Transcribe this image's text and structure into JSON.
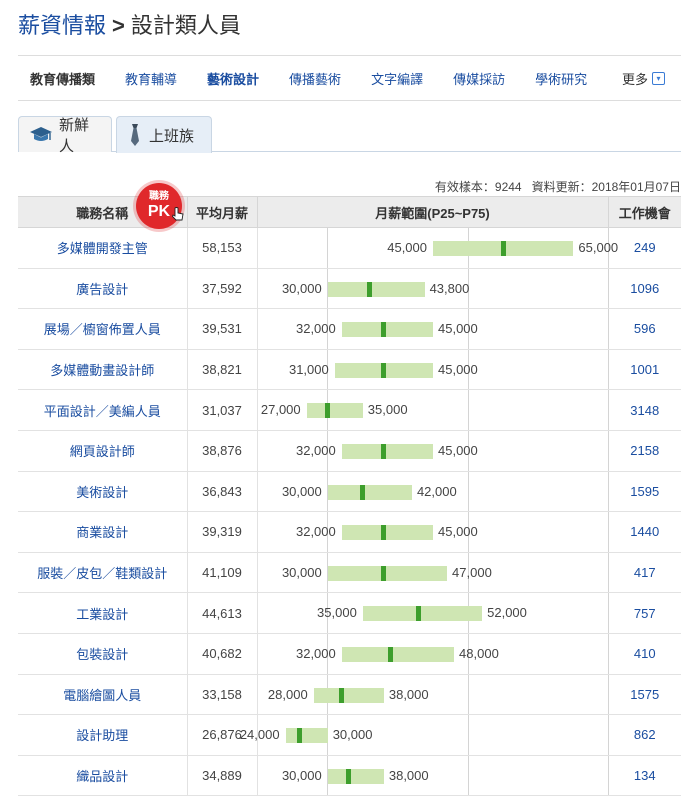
{
  "breadcrumb": {
    "root": "薪資情報",
    "separator": ">",
    "current": "設計類人員"
  },
  "categories": {
    "items": [
      {
        "label": "教育傳播類",
        "type": "first"
      },
      {
        "label": "教育輔導",
        "type": "link"
      },
      {
        "label": "藝術設計",
        "type": "active"
      },
      {
        "label": "傳播藝術",
        "type": "link"
      },
      {
        "label": "文字編譯",
        "type": "link"
      },
      {
        "label": "傳媒採訪",
        "type": "link"
      },
      {
        "label": "學術研究",
        "type": "link"
      }
    ],
    "more_label": "更多",
    "more_icon": "▾"
  },
  "tabs": [
    {
      "label": "新鮮人",
      "icon": "graduation-cap-icon"
    },
    {
      "label": "上班族",
      "icon": "necktie-icon"
    }
  ],
  "meta": {
    "sample": "有效樣本：9244",
    "updated": "資料更新：2018年01月07日"
  },
  "table": {
    "headers": {
      "name": "職務名稱",
      "avg": "平均月薪",
      "range": "月薪範圍(P25~P75)",
      "count": "工作機會"
    },
    "pk_badge": {
      "line1": "職務",
      "line2": "PK"
    },
    "scale_min": 20000,
    "scale_max": 70000,
    "rows": [
      {
        "name": "多媒體開發主管",
        "avg": "58,153",
        "p25": "45,000",
        "p75": "65,000",
        "p25_value": 45000,
        "p75_value": 65000,
        "median_value": 55000,
        "count": "249"
      },
      {
        "name": "廣告設計",
        "avg": "37,592",
        "p25": "30,000",
        "p75": "43,800",
        "p25_value": 30000,
        "p75_value": 43800,
        "median_value": 36000,
        "count": "1096"
      },
      {
        "name": "展場／櫥窗佈置人員",
        "avg": "39,531",
        "p25": "32,000",
        "p75": "45,000",
        "p25_value": 32000,
        "p75_value": 45000,
        "median_value": 38000,
        "count": "596"
      },
      {
        "name": "多媒體動畫設計師",
        "avg": "38,821",
        "p25": "31,000",
        "p75": "45,000",
        "p25_value": 31000,
        "p75_value": 45000,
        "median_value": 38000,
        "count": "1001"
      },
      {
        "name": "平面設計／美編人員",
        "avg": "31,037",
        "p25": "27,000",
        "p75": "35,000",
        "p25_value": 27000,
        "p75_value": 35000,
        "median_value": 30000,
        "count": "3148"
      },
      {
        "name": "網頁設計師",
        "avg": "38,876",
        "p25": "32,000",
        "p75": "45,000",
        "p25_value": 32000,
        "p75_value": 45000,
        "median_value": 38000,
        "count": "2158"
      },
      {
        "name": "美術設計",
        "avg": "36,843",
        "p25": "30,000",
        "p75": "42,000",
        "p25_value": 30000,
        "p75_value": 42000,
        "median_value": 35000,
        "count": "1595"
      },
      {
        "name": "商業設計",
        "avg": "39,319",
        "p25": "32,000",
        "p75": "45,000",
        "p25_value": 32000,
        "p75_value": 45000,
        "median_value": 38000,
        "count": "1440"
      },
      {
        "name": "服裝／皮包／鞋類設計",
        "avg": "41,109",
        "p25": "30,000",
        "p75": "47,000",
        "p25_value": 30000,
        "p75_value": 47000,
        "median_value": 38000,
        "count": "417"
      },
      {
        "name": "工業設計",
        "avg": "44,613",
        "p25": "35,000",
        "p75": "52,000",
        "p25_value": 35000,
        "p75_value": 52000,
        "median_value": 43000,
        "count": "757"
      },
      {
        "name": "包裝設計",
        "avg": "40,682",
        "p25": "32,000",
        "p75": "48,000",
        "p25_value": 32000,
        "p75_value": 48000,
        "median_value": 39000,
        "count": "410"
      },
      {
        "name": "電腦繪圖人員",
        "avg": "33,158",
        "p25": "28,000",
        "p75": "38,000",
        "p25_value": 28000,
        "p75_value": 38000,
        "median_value": 32000,
        "count": "1575"
      },
      {
        "name": "設計助理",
        "avg": "26,876",
        "p25": "24,000",
        "p75": "30,000",
        "p25_value": 24000,
        "p75_value": 30000,
        "median_value": 26000,
        "count": "862"
      },
      {
        "name": "織品設計",
        "avg": "34,889",
        "p25": "30,000",
        "p75": "38,000",
        "p25_value": 30000,
        "p75_value": 38000,
        "median_value": 33000,
        "count": "134"
      }
    ]
  },
  "colors": {
    "link": "#1a4da0",
    "bar": "#cfe6b3",
    "median": "#3d9e2c",
    "badge": "#e0282b",
    "header_bg": "#ececec"
  }
}
